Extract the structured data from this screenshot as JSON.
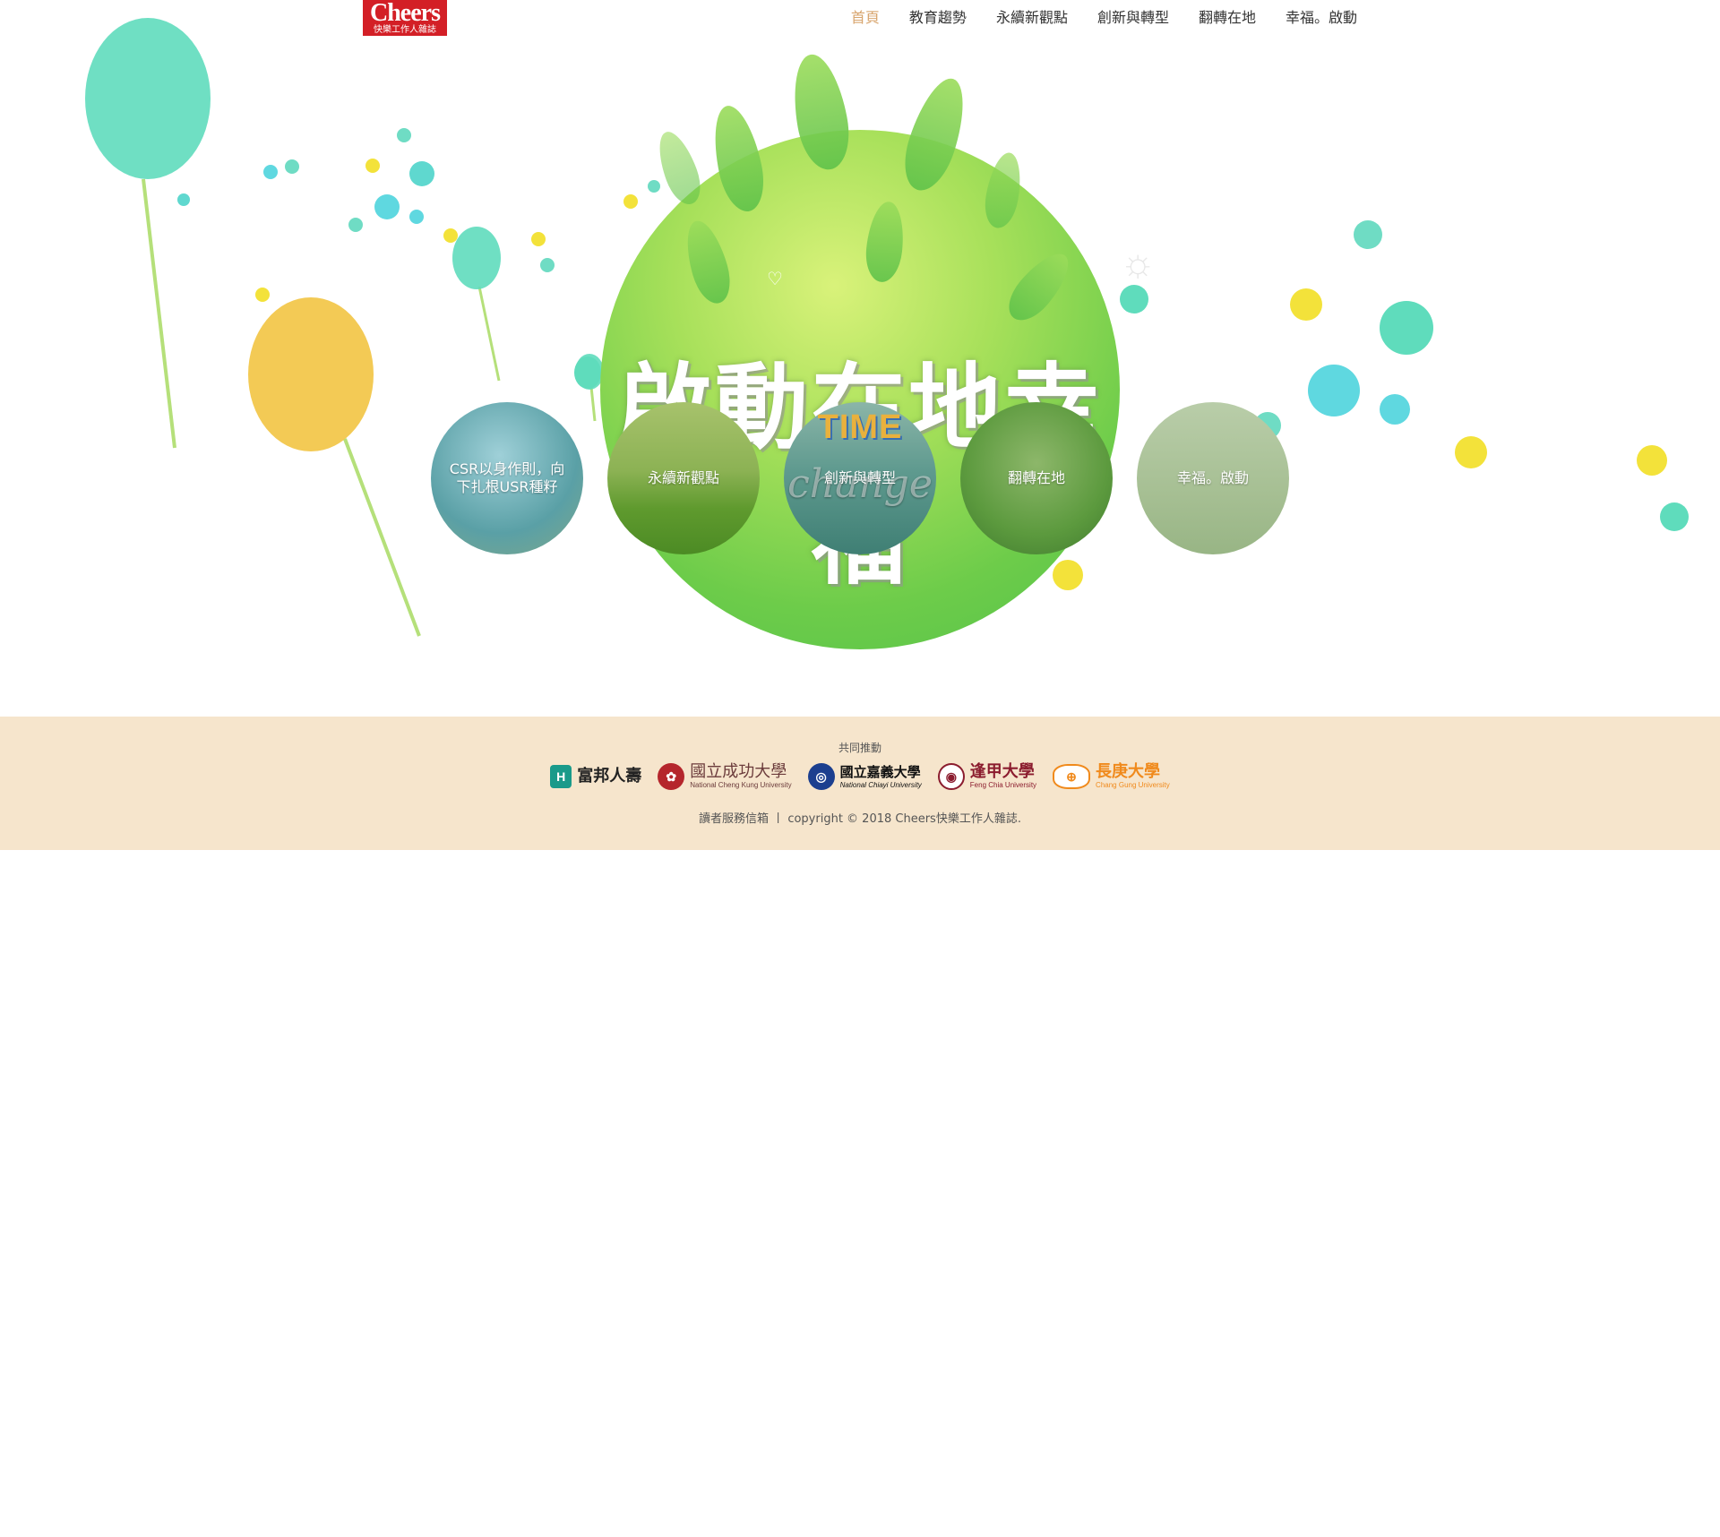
{
  "header": {
    "logo_brand": "Cheers",
    "logo_sub": "快樂工作人雜誌",
    "nav": [
      {
        "label": "首頁",
        "active": true
      },
      {
        "label": "教育趨勢"
      },
      {
        "label": "永續新觀點"
      },
      {
        "label": "創新與轉型"
      },
      {
        "label": "翻轉在地"
      },
      {
        "label": "幸福。啟動"
      }
    ]
  },
  "hero": {
    "title": "啟動在地幸福",
    "circles": [
      {
        "label": "CSR以身作則，向下扎根USR種籽"
      },
      {
        "label": "永續新觀點"
      },
      {
        "label": "創新與轉型",
        "image_word_top": "TIME",
        "image_word_bottom": "change"
      },
      {
        "label": "翻轉在地"
      },
      {
        "label": "幸福。啟動"
      }
    ],
    "colors": {
      "globe": "#6dcc4a",
      "balloon_teal": "#5fdcbc",
      "balloon_yellow": "#f2c443"
    }
  },
  "footer": {
    "label": "共同推動",
    "partners": [
      {
        "name": "富邦人壽",
        "icon": "fubon-logo-icon"
      },
      {
        "name": "國立成功大學",
        "en": "National Cheng Kung University",
        "icon": "ncku-logo-icon"
      },
      {
        "name": "國立嘉義大學",
        "en": "National Chiayi University",
        "icon": "ncyu-logo-icon"
      },
      {
        "name": "逢甲大學",
        "en": "Feng Chia University",
        "icon": "fcu-logo-icon"
      },
      {
        "name": "長庚大學",
        "en": "Chang Gung University",
        "icon": "cgu-logo-icon"
      }
    ],
    "service_link": "讀者服務信箱",
    "separator": "丨",
    "copyright": "copyright © 2018 Cheers快樂工作人雜誌."
  }
}
